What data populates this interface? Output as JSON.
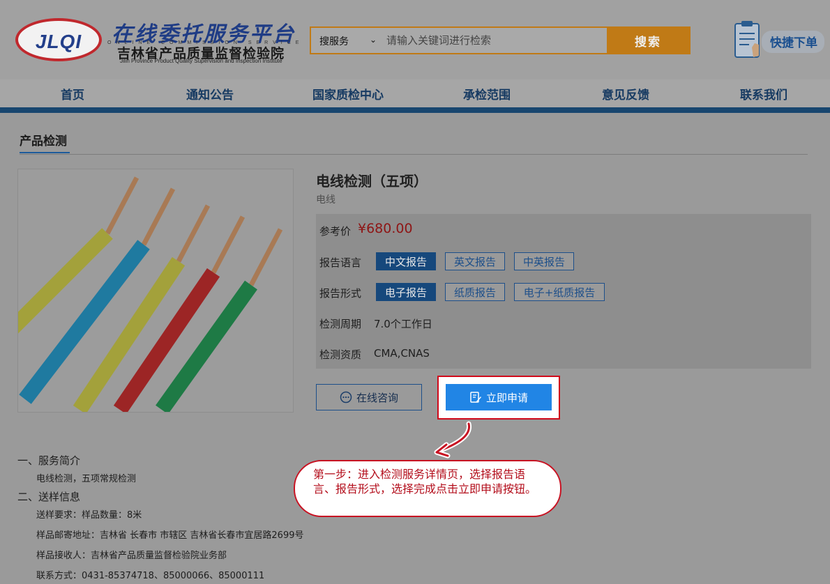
{
  "header": {
    "logo_abbr": "JLQI",
    "logo_title": "在线委托服务平台",
    "logo_sub_en": "ONLINE COMMISSION SERVICE PLATFORM",
    "logo_org": "吉林省产品质量监督检验院",
    "logo_org_en": "Jilin Province Product Quality Supervision and Inspection Institute",
    "search_select": "搜服务",
    "search_placeholder": "请输入关键词进行检索",
    "search_button": "搜索",
    "quick_order": "快捷下单"
  },
  "nav": [
    "首页",
    "通知公告",
    "国家质检中心",
    "承检范围",
    "意见反馈",
    "联系我们"
  ],
  "section_title": "产品检测",
  "product": {
    "title": "电线检测（五项）",
    "subtitle": "电线",
    "price_label": "参考价",
    "price": "¥680.00",
    "language_label": "报告语言",
    "languages": [
      "中文报告",
      "英文报告",
      "中英报告"
    ],
    "form_label": "报告形式",
    "forms": [
      "电子报告",
      "纸质报告",
      "电子+纸质报告"
    ],
    "cycle_label": "检测周期",
    "cycle": "7.0个工作日",
    "qual_label": "检测资质",
    "qual": "CMA,CNAS"
  },
  "buttons": {
    "consult": "在线咨询",
    "apply": "立即申请"
  },
  "callout": "第一步：进入检测服务详情页，选择报告语言、报告形式，选择完成点击立即申请按钮。",
  "details": {
    "s1_title": "一、服务简介",
    "s1_text": "电线检测，五项常规检测",
    "s2_title": "二、送样信息",
    "req": "送样要求：样品数量：8米",
    "addr": "样品邮寄地址：吉林省 长春市 市辖区 吉林省长春市宜居路2699号",
    "recv": "样品接收人：吉林省产品质量监督检验院业务部",
    "contact": "联系方式：0431-85374718、85000066、85000111"
  },
  "colors": {
    "accent": "#2185e5",
    "highlight": "#d0091a",
    "brand": "#1f3c85",
    "search": "#c07a16"
  }
}
